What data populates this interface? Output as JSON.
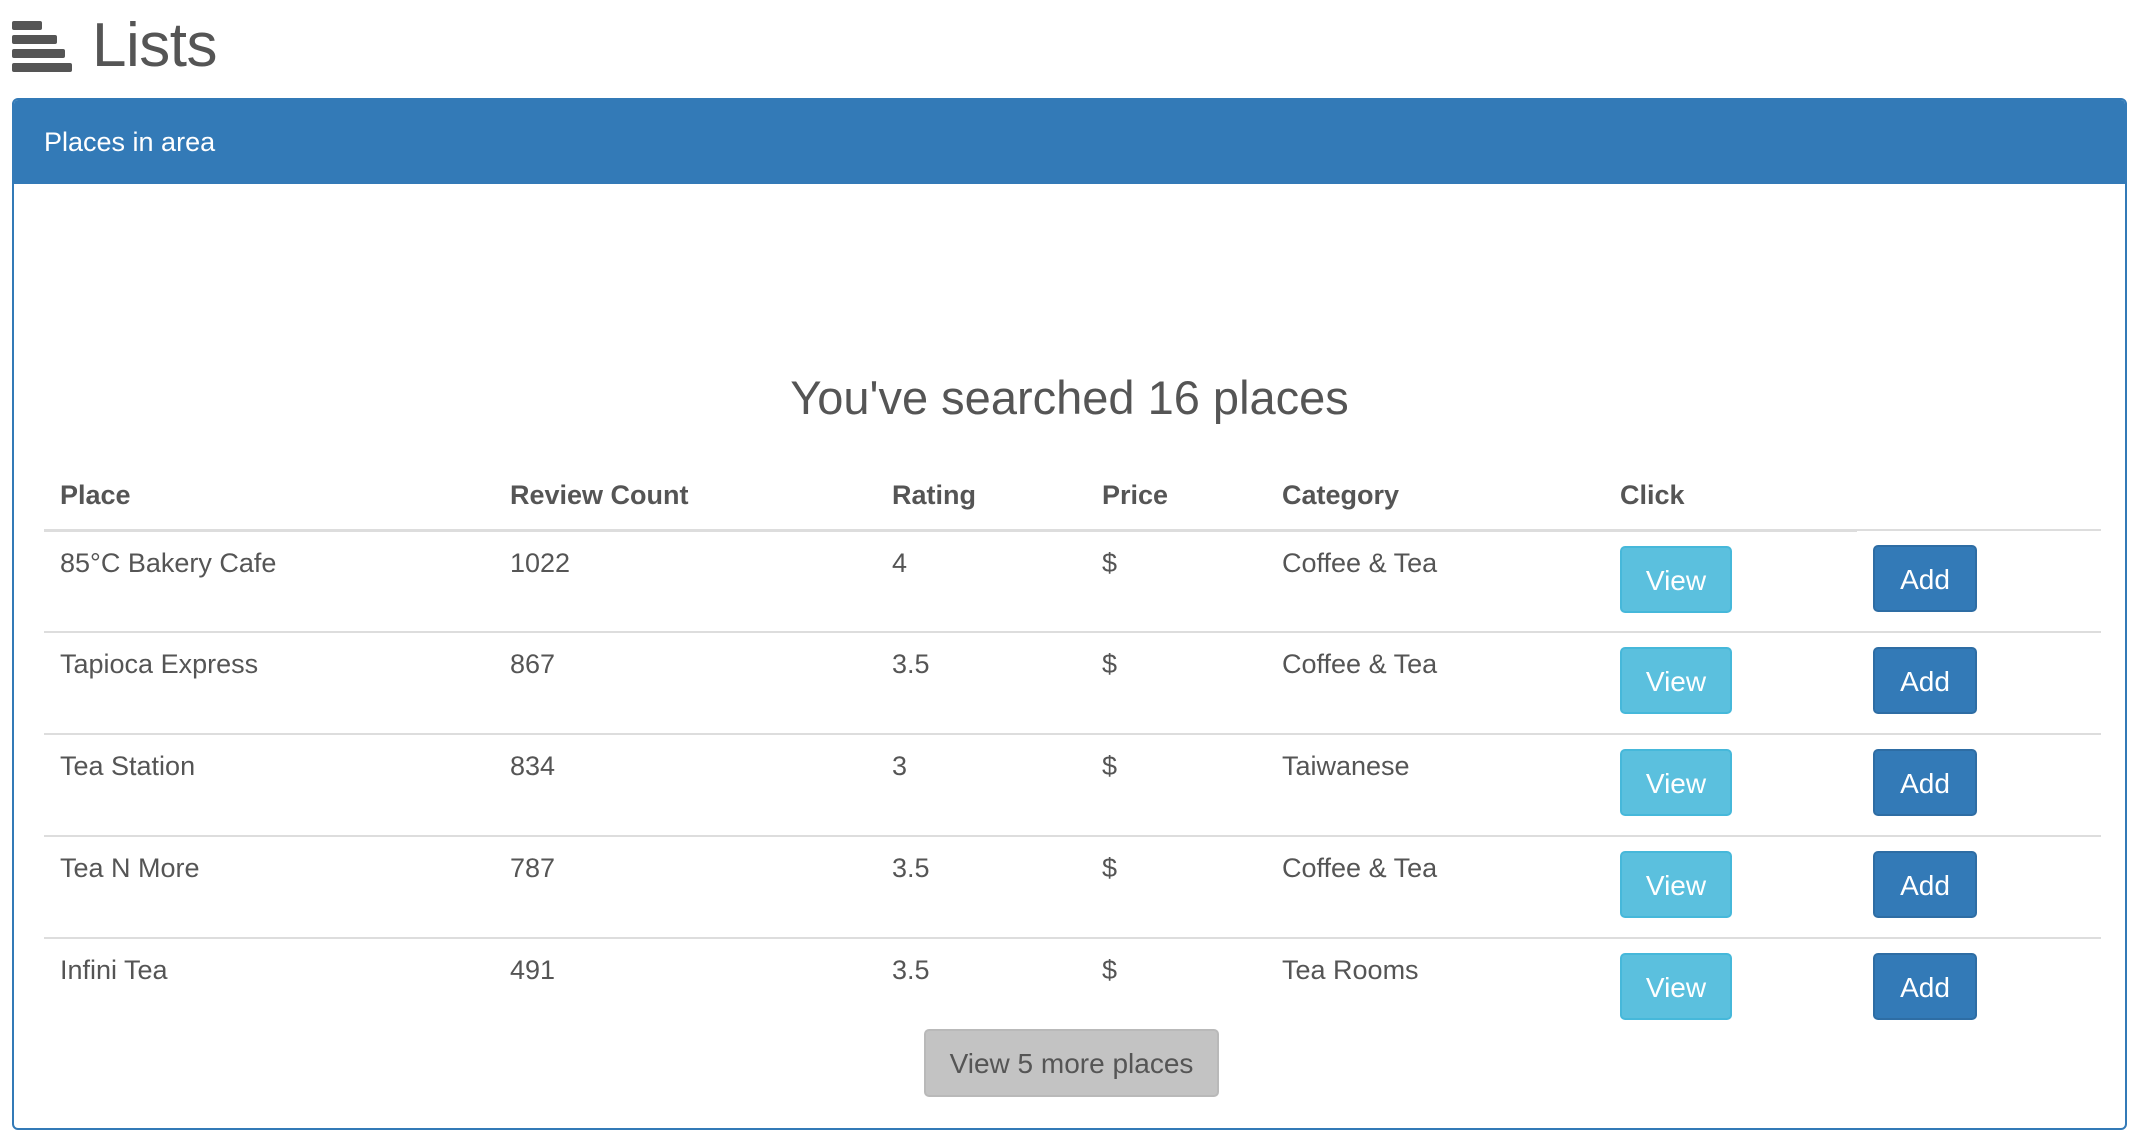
{
  "header": {
    "icon": "lines-icon",
    "title": "Lists"
  },
  "panel": {
    "heading": "Places in area",
    "search_summary": "You've searched 16 places",
    "columns": [
      "Place",
      "Review Count",
      "Rating",
      "Price",
      "Category",
      "Click"
    ],
    "rows": [
      {
        "place": "85°C Bakery Cafe",
        "review_count": "1022",
        "rating": "4",
        "price": "$",
        "category": "Coffee & Tea",
        "view_label": "View",
        "add_label": "Add"
      },
      {
        "place": "Tapioca Express",
        "review_count": "867",
        "rating": "3.5",
        "price": "$",
        "category": "Coffee & Tea",
        "view_label": "View",
        "add_label": "Add"
      },
      {
        "place": "Tea Station",
        "review_count": "834",
        "rating": "3",
        "price": "$",
        "category": "Taiwanese",
        "view_label": "View",
        "add_label": "Add"
      },
      {
        "place": "Tea N More",
        "review_count": "787",
        "rating": "3.5",
        "price": "$",
        "category": "Coffee & Tea",
        "view_label": "View",
        "add_label": "Add"
      },
      {
        "place": "Infini Tea",
        "review_count": "491",
        "rating": "3.5",
        "price": "$",
        "category": "Tea Rooms",
        "view_label": "View",
        "add_label": "Add"
      }
    ],
    "more_button_label": "View 5 more places"
  },
  "colors": {
    "primary": "#337ab7",
    "info": "#5bc0de",
    "muted_button": "#c3c3c3",
    "text": "#555555"
  }
}
